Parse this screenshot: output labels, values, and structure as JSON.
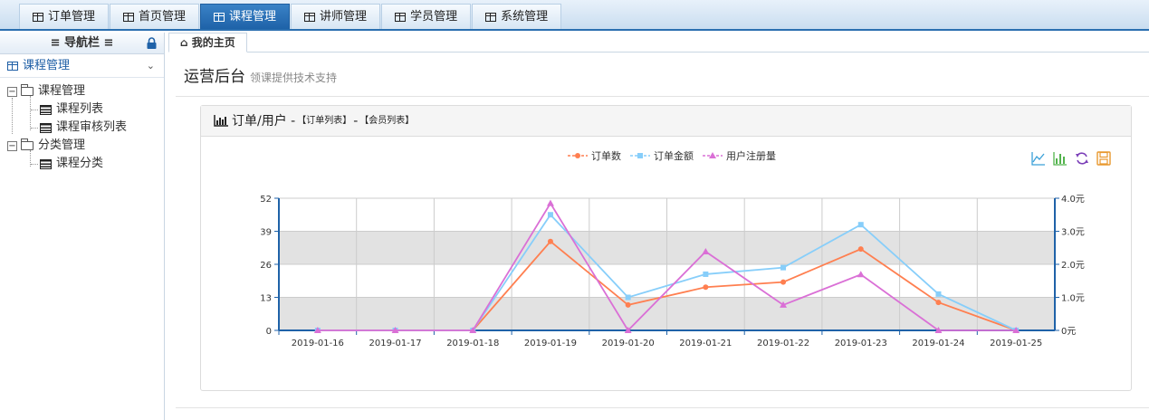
{
  "nav_tabs": [
    {
      "label": "订单管理"
    },
    {
      "label": "首页管理"
    },
    {
      "label": "课程管理",
      "active": true
    },
    {
      "label": "讲师管理"
    },
    {
      "label": "学员管理"
    },
    {
      "label": "系统管理"
    }
  ],
  "sidebar": {
    "title": "≡ 导航栏 ≡",
    "section": "课程管理",
    "tree": [
      {
        "label": "课程管理",
        "children": [
          "课程列表",
          "课程审核列表"
        ]
      },
      {
        "label": "分类管理",
        "children": [
          "课程分类"
        ]
      }
    ]
  },
  "main": {
    "page_tab": "我的主页",
    "title": "运营后台",
    "subtitle": "领课提供技术支持",
    "panel": {
      "title_main": "订单/用户 -",
      "link_orders": "【订单列表】",
      "sep": "-",
      "link_members": "【会员列表】"
    }
  },
  "colors": {
    "orders": "#ff7f50",
    "amount": "#87cefa",
    "users": "#da70d6",
    "accent": "#1f62a8"
  },
  "chart_data": {
    "type": "line",
    "categories": [
      "2019-01-16",
      "2019-01-17",
      "2019-01-18",
      "2019-01-19",
      "2019-01-20",
      "2019-01-21",
      "2019-01-22",
      "2019-01-23",
      "2019-01-24",
      "2019-01-25"
    ],
    "series": [
      {
        "name": "订单数",
        "axis": "left",
        "marker": "circle",
        "values": [
          0,
          0,
          0,
          35,
          10,
          17,
          19,
          32,
          11,
          0
        ]
      },
      {
        "name": "订单金额",
        "axis": "right",
        "marker": "square",
        "values": [
          0,
          0,
          0,
          3.5,
          1.0,
          1.7,
          1.9,
          3.2,
          1.1,
          0
        ]
      },
      {
        "name": "用户注册量",
        "axis": "left",
        "marker": "triangle",
        "values": [
          0,
          0,
          0,
          50,
          0,
          31,
          10,
          22,
          0,
          0
        ]
      }
    ],
    "ylim_left": [
      0,
      52
    ],
    "yticks_left": [
      "0",
      "13",
      "26",
      "39",
      "52"
    ],
    "ylim_right": [
      0,
      4.0
    ],
    "yticks_right": [
      "0元",
      "1.0元",
      "2.0元",
      "3.0元",
      "4.0元"
    ],
    "split_area": true,
    "grid": true,
    "legend_position": "top-center"
  }
}
